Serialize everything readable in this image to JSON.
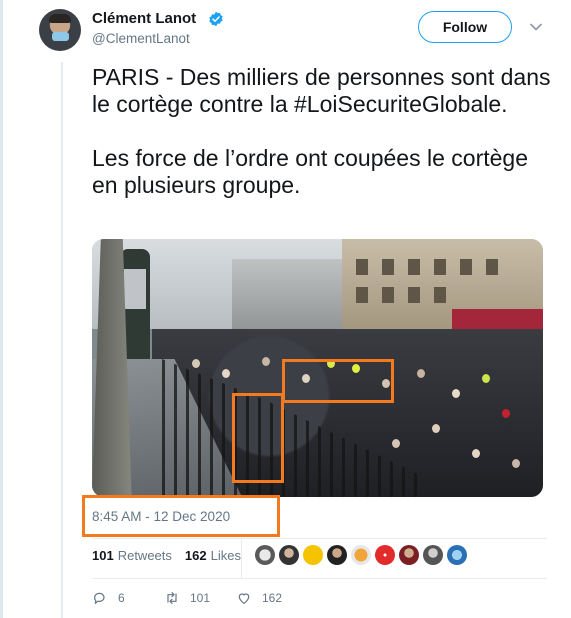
{
  "author": {
    "name": "Clément Lanot",
    "handle": "@ClementLanot",
    "verified": true,
    "follow_label": "Follow"
  },
  "tweet": {
    "text": "PARIS - Des milliers de personnes sont dans le cortège contre la #LoiSecuriteGlobale.\n\nLes force de l’ordre ont coupées le cortège en plusieurs groupe.",
    "timestamp": "8:45 AM - 12 Dec 2020"
  },
  "stats": {
    "retweets_count": "101",
    "retweets_label": "Retweets",
    "likes_count": "162",
    "likes_label": "Likes"
  },
  "actions": {
    "replies": "6",
    "retweets": "101",
    "likes": "162"
  },
  "colors": {
    "brand_blue": "#1da1f2",
    "highlight_orange": "#f47a20",
    "secondary_text": "#657786"
  },
  "icons": {
    "verified": "verified-badge-icon",
    "more": "chevron-down-icon",
    "reply": "reply-icon",
    "retweet": "retweet-icon",
    "like": "heart-icon"
  }
}
